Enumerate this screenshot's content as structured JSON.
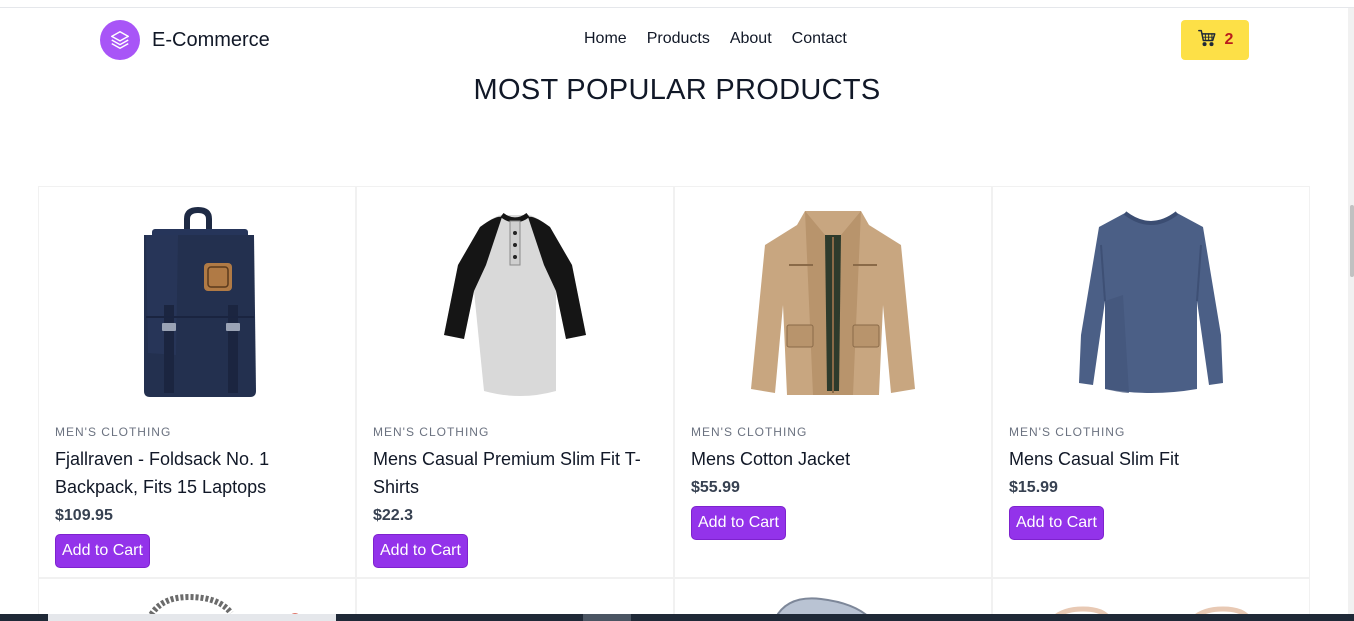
{
  "brand": {
    "name": "E-Commerce",
    "logo_icon": "layers-icon",
    "accent": "#a855f7"
  },
  "nav": {
    "items": [
      "Home",
      "Products",
      "About",
      "Contact"
    ]
  },
  "cart": {
    "icon": "cart-icon",
    "count": "2",
    "color": "#fde047"
  },
  "page": {
    "title": "MOST POPULAR PRODUCTS"
  },
  "products": [
    {
      "category": "MEN'S CLOTHING",
      "title": "Fjallraven - Foldsack No. 1 Backpack, Fits 15 Laptops",
      "price": "$109.95",
      "button": "Add to Cart",
      "image_icon": "backpack-image"
    },
    {
      "category": "MEN'S CLOTHING",
      "title": "Mens Casual Premium Slim Fit T-Shirts",
      "price": "$22.3",
      "button": "Add to Cart",
      "image_icon": "raglan-tshirt-image"
    },
    {
      "category": "MEN'S CLOTHING",
      "title": "Mens Cotton Jacket",
      "price": "$55.99",
      "button": "Add to Cart",
      "image_icon": "jacket-image"
    },
    {
      "category": "MEN'S CLOTHING",
      "title": "Mens Casual Slim Fit",
      "price": "$15.99",
      "button": "Add to Cart",
      "image_icon": "longsleeve-shirt-image"
    }
  ],
  "colors": {
    "button": "#9333ea",
    "cart_badge_text": "#b91c1c"
  }
}
